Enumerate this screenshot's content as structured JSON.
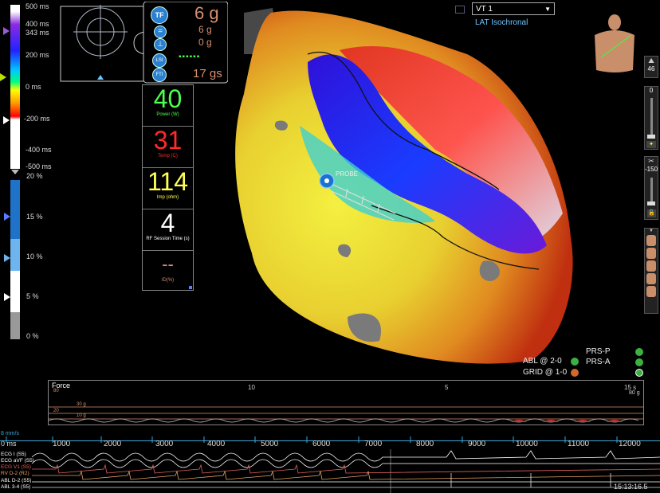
{
  "lat_scale": {
    "ticks": [
      "500 ms",
      "400 ms",
      "343 ms",
      "200 ms",
      "0 ms",
      "-200 ms",
      "-400 ms",
      "-500 ms"
    ]
  },
  "force_scale": {
    "ticks": [
      "20 %",
      "15 %",
      "10 %",
      "5 %",
      "0 %"
    ]
  },
  "catheter": {
    "tf_label": "TF",
    "lsi_label": "LSI",
    "fti_label": "FTI",
    "force_main": "6 g",
    "force_a": "6 g",
    "force_b": "0 g",
    "fti_value": "17 gs"
  },
  "rf_panel": {
    "power_value": "40",
    "power_label": "Power (W)",
    "temp_value": "31",
    "temp_label": "Temp (C)",
    "imp_value": "114",
    "imp_label": "Imp (ohm)",
    "session_value": "4",
    "session_label": "RF Session Time (s)",
    "id_value": "--",
    "id_label": "ID(%)"
  },
  "map_header": {
    "selected_map": "VT 1",
    "mode": "LAT Isochronal"
  },
  "map": {
    "catheter_label": "PROBE"
  },
  "toolbar": {
    "mountain_value": "46",
    "slider_top": "0",
    "slider_bottom": "-150"
  },
  "legend": {
    "items": [
      {
        "label": "ABL @ 2-0",
        "color": "#3cb043"
      },
      {
        "label": "GRID @ 1-0",
        "color": "#d06a2a"
      },
      {
        "label": "PRS-P",
        "color": "#3cb043"
      },
      {
        "label": "PRS-A",
        "color": "#3cb043"
      }
    ]
  },
  "force_panel": {
    "title": "Force",
    "ticks": [
      "10",
      "5",
      "15 s"
    ],
    "line_labels": [
      "30 g",
      "20",
      "10 g"
    ],
    "right_label": "80 g",
    "top_left": "80"
  },
  "ecg": {
    "scale_label": "8 mm/s",
    "start_label": "0 ms",
    "time_ticks": [
      "1000",
      "2000",
      "3000",
      "4000",
      "5000",
      "6000",
      "7000",
      "8000",
      "9000",
      "10000",
      "11000",
      "12000"
    ],
    "channels": [
      {
        "label": "ECG I (S5)",
        "color": "#ffffff"
      },
      {
        "label": "ECG aVF (S5)",
        "color": "#ffffff"
      },
      {
        "label": "ECG V1 (S5)",
        "color": "#e06060"
      },
      {
        "label": "RV   D-2 (R2)",
        "color": "#e8a060"
      },
      {
        "label": "ABL  D-2 (S5)",
        "color": "#ffffff"
      },
      {
        "label": "ABL  3-4 (S5)",
        "color": "#ffffff"
      }
    ],
    "clock": "15:13:16.5"
  },
  "colors": {
    "accent_blue": "#1e73c8",
    "power_green": "#4cff4c",
    "temp_red": "#ff2a2a",
    "imp_yellow": "#ffff55",
    "force_orange": "#d89070"
  }
}
